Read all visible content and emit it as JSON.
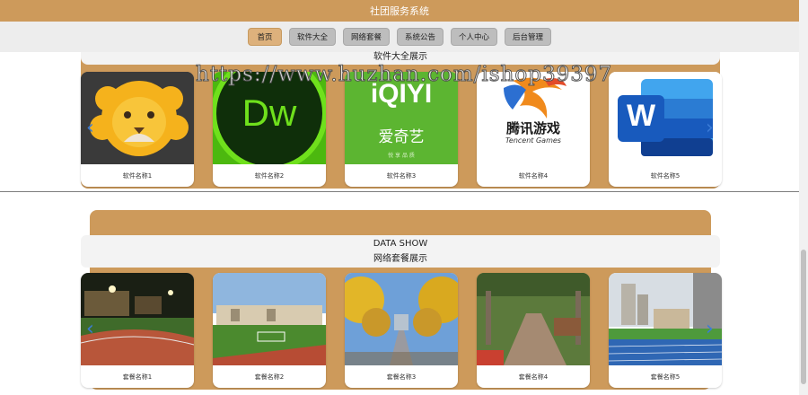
{
  "app_title": "社团服务系统",
  "nav": [
    {
      "label": "首页",
      "active": true
    },
    {
      "label": "软件大全",
      "active": false
    },
    {
      "label": "网络套餐",
      "active": false
    },
    {
      "label": "系统公告",
      "active": false
    },
    {
      "label": "个人中心",
      "active": false
    },
    {
      "label": "后台管理",
      "active": false
    }
  ],
  "watermark": "https://www.huzhan.com/ishop39397",
  "software_section": {
    "title": "软件大全展示",
    "items": [
      {
        "name": "软件名称1",
        "icon": "lion-app-icon"
      },
      {
        "name": "软件名称2",
        "icon": "dreamweaver-icon",
        "logo_text": "Dw"
      },
      {
        "name": "软件名称3",
        "icon": "iqiyi-icon",
        "logo_text": "iQIYI",
        "sub_text": "爱奇艺",
        "tagline": "悦 享 品 质"
      },
      {
        "name": "软件名称4",
        "icon": "tencent-games-icon",
        "logo_text": "腾讯游戏",
        "sub_text": "Tencent Games"
      },
      {
        "name": "软件名称5",
        "icon": "word-icon",
        "logo_text": "W"
      }
    ]
  },
  "package_section": {
    "title_en": "DATA SHOW",
    "title": "网络套餐展示",
    "items": [
      {
        "name": "套餐名称1",
        "icon": "night-stadium-photo"
      },
      {
        "name": "套餐名称2",
        "icon": "campus-field-photo"
      },
      {
        "name": "套餐名称3",
        "icon": "ginkgo-avenue-photo"
      },
      {
        "name": "套餐名称4",
        "icon": "wisteria-corridor-photo"
      },
      {
        "name": "套餐名称5",
        "icon": "running-track-photo"
      }
    ]
  },
  "colors": {
    "brand": "#cd9a5b",
    "nav_active": "#ddb17c",
    "arrow": "#3b7bd6"
  }
}
